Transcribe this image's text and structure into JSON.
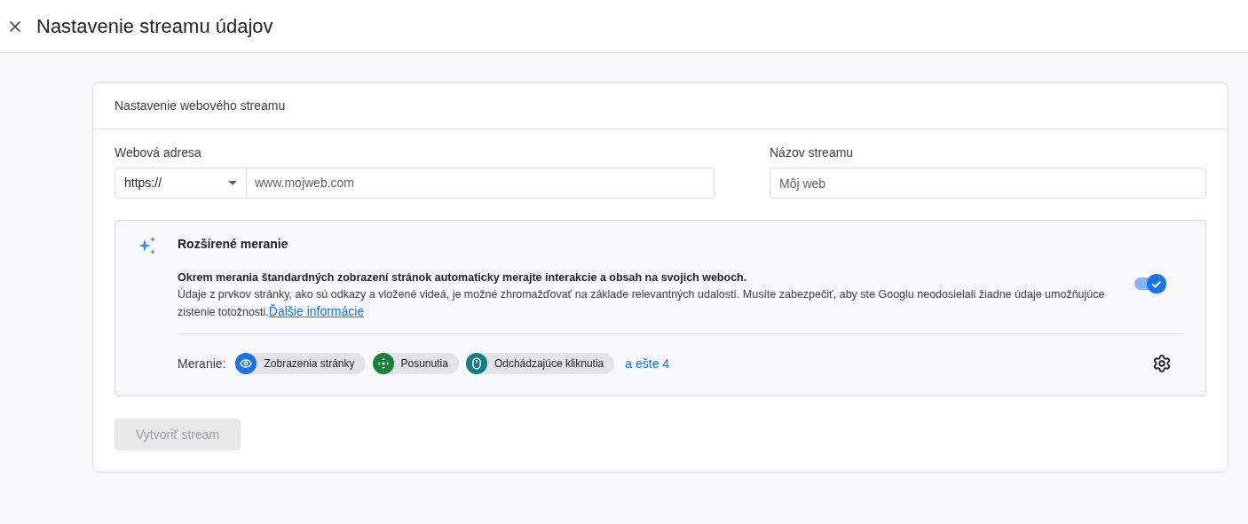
{
  "window": {
    "title": "Nastavenie streamu údajov"
  },
  "card": {
    "title": "Nastavenie webového streamu"
  },
  "url_field": {
    "label": "Webová adresa",
    "protocol": "https://",
    "placeholder": "www.mojweb.com"
  },
  "name_field": {
    "label": "Názov streamu",
    "placeholder": "Môj web"
  },
  "enhanced": {
    "title": "Rozšírené meranie",
    "lead": "Okrem merania štandardných zobrazení stránok automaticky merajte interakcie a obsah na svojich weboch.",
    "body": "Údaje z prvkov stránky, ako sú odkazy a vložené videá, je možné zhromažďovať na základe relevantných udalostí. Musíte zabezpečiť, aby ste Googlu neodosielali žiadne údaje umožňujúce zistenie totožnosti.",
    "link": "Ďalšie informácie",
    "on": true,
    "measures_label": "Meranie:",
    "chips": [
      {
        "kind": "eye",
        "label": "Zobrazenia stránky",
        "color": "#1a73e8"
      },
      {
        "kind": "scroll",
        "label": "Posunutia",
        "color": "#188038"
      },
      {
        "kind": "mouse",
        "label": "Odchádzajúce kliknutia",
        "color": "#137d83"
      }
    ],
    "more": "a ešte 4"
  },
  "create_button": {
    "label": "Vytvoriť stream",
    "disabled": true
  }
}
